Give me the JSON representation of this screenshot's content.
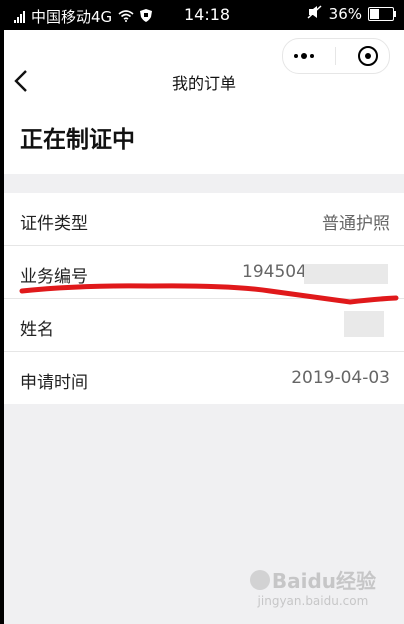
{
  "status_bar": {
    "carrier": "中国移动4G",
    "time": "14:18",
    "battery": "36%"
  },
  "header": {
    "title": "我的订单"
  },
  "order_status": "正在制证中",
  "details": [
    {
      "label": "证件类型",
      "value": "普通护照"
    },
    {
      "label": "业务编号",
      "value": "194504"
    },
    {
      "label": "姓名",
      "value": ""
    },
    {
      "label": "申请时间",
      "value": "2019-04-03"
    }
  ],
  "watermark": {
    "brand": "Baidu经验",
    "url": "jingyan.baidu.com"
  },
  "colors": {
    "scribble": "#e0191b",
    "page_bg": "#f0f0f2"
  }
}
